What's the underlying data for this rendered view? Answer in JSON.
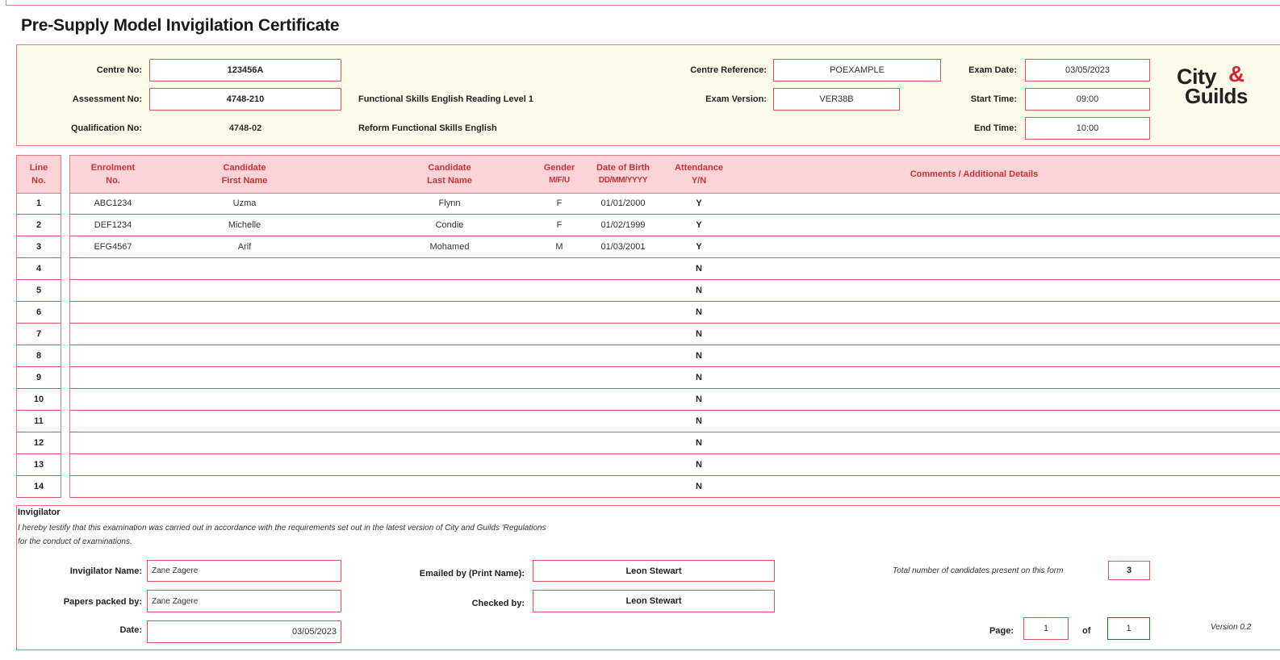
{
  "title": "Pre-Supply Model Invigilation Certificate",
  "header": {
    "centre_no_label": "Centre No:",
    "centre_no": "123456A",
    "assessment_no_label": "Assessment No:",
    "assessment_no": "4748-210",
    "assessment_name": "Functional Skills English Reading Level 1",
    "qualification_no_label": "Qualification No:",
    "qualification_no": "4748-02",
    "qualification_name": "Reform Functional Skills English",
    "centre_reference_label": "Centre Reference:",
    "centre_reference": "POEXAMPLE",
    "exam_version_label": "Exam Version:",
    "exam_version": "VER38B",
    "exam_date_label": "Exam Date:",
    "exam_date": "03/05/2023",
    "start_time_label": "Start Time:",
    "start_time": "09:00",
    "end_time_label": "End Time:",
    "end_time": "10:00"
  },
  "logo": {
    "city": "City",
    "amp": "&",
    "guilds": "Guilds"
  },
  "table": {
    "headers": {
      "line_no": [
        "Line",
        "No."
      ],
      "enrolment": [
        "Enrolment",
        "No."
      ],
      "first_name": [
        "Candidate",
        "First Name"
      ],
      "last_name": [
        "Candidate",
        "Last Name"
      ],
      "gender": [
        "Gender",
        "M/F/U"
      ],
      "dob": [
        "Date of Birth",
        "DD/MM/YYYY"
      ],
      "attendance": [
        "Attendance",
        "Y/N"
      ],
      "comments": "Comments / Additional Details"
    },
    "rows": [
      {
        "line": "1",
        "enrolment": "ABC1234",
        "first": "Uzma",
        "last": "Flynn",
        "gender": "F",
        "dob": "01/01/2000",
        "att": "Y"
      },
      {
        "line": "2",
        "enrolment": "DEF1234",
        "first": "Michelle",
        "last": "Condie",
        "gender": "F",
        "dob": "01/02/1999",
        "att": "Y"
      },
      {
        "line": "3",
        "enrolment": "EFG4567",
        "first": "Arif",
        "last": "Mohamed",
        "gender": "M",
        "dob": "01/03/2001",
        "att": "Y"
      },
      {
        "line": "4",
        "enrolment": "",
        "first": "",
        "last": "",
        "gender": "",
        "dob": "",
        "att": "N"
      },
      {
        "line": "5",
        "enrolment": "",
        "first": "",
        "last": "",
        "gender": "",
        "dob": "",
        "att": "N"
      },
      {
        "line": "6",
        "enrolment": "",
        "first": "",
        "last": "",
        "gender": "",
        "dob": "",
        "att": "N"
      },
      {
        "line": "7",
        "enrolment": "",
        "first": "",
        "last": "",
        "gender": "",
        "dob": "",
        "att": "N"
      },
      {
        "line": "8",
        "enrolment": "",
        "first": "",
        "last": "",
        "gender": "",
        "dob": "",
        "att": "N"
      },
      {
        "line": "9",
        "enrolment": "",
        "first": "",
        "last": "",
        "gender": "",
        "dob": "",
        "att": "N"
      },
      {
        "line": "10",
        "enrolment": "",
        "first": "",
        "last": "",
        "gender": "",
        "dob": "",
        "att": "N"
      },
      {
        "line": "11",
        "enrolment": "",
        "first": "",
        "last": "",
        "gender": "",
        "dob": "",
        "att": "N"
      },
      {
        "line": "12",
        "enrolment": "",
        "first": "",
        "last": "",
        "gender": "",
        "dob": "",
        "att": "N"
      },
      {
        "line": "13",
        "enrolment": "",
        "first": "",
        "last": "",
        "gender": "",
        "dob": "",
        "att": "N"
      },
      {
        "line": "14",
        "enrolment": "",
        "first": "",
        "last": "",
        "gender": "",
        "dob": "",
        "att": "N"
      }
    ]
  },
  "footer": {
    "invigilator_title": "Invigilator",
    "statement_line1": "I hereby testify that this examination was carried out in accordance with the requirements set out in the latest version of City and Guilds 'Regulations",
    "statement_line2": "for the conduct of examinations.",
    "invigilator_name_label": "Invigilator Name:",
    "invigilator_name": "Zane Zagere",
    "papers_packed_label": "Papers packed by:",
    "papers_packed": "Zane Zagere",
    "date_label": "Date:",
    "date": "03/05/2023",
    "emailed_by_label": "Emailed by (Print Name):",
    "emailed_by": "Leon Stewart",
    "checked_by_label": "Checked by:",
    "checked_by": "Leon Stewart",
    "total_label": "Total number of candidates present on this form",
    "total": "3",
    "page_label": "Page:",
    "page": "1",
    "of_label": "of",
    "page_total": "1",
    "version": "Version 0.2"
  },
  "colors": {
    "border": "#e07a82",
    "header_bg": "#fdfbe9",
    "table_header_bg": "#fcd4d7",
    "header_text": "#c8323d"
  }
}
